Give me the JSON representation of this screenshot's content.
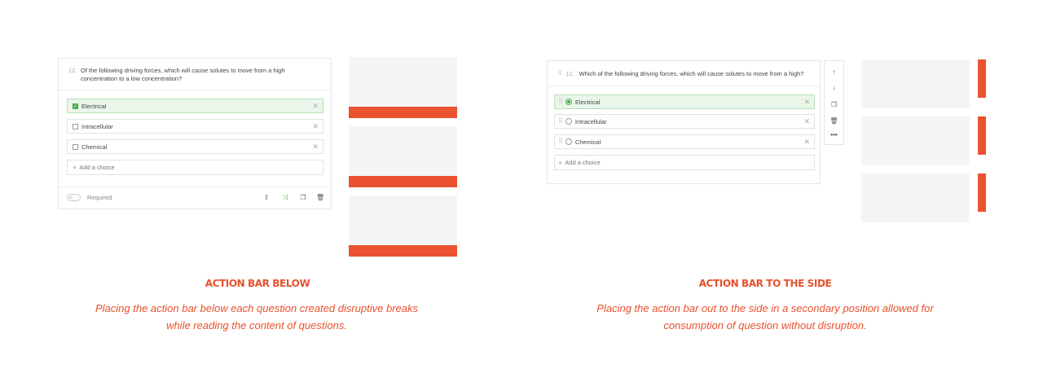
{
  "left": {
    "question": {
      "number": "12.",
      "text": "Of the following driving forces, which will cause solutes to move from a high concentration to a low concentration?"
    },
    "choices": [
      {
        "label": "Electrical",
        "selected": true
      },
      {
        "label": "Intracellular",
        "selected": false
      },
      {
        "label": "Chemical",
        "selected": false
      }
    ],
    "add_choice": "Add a choice",
    "required_label": "Required",
    "toolbar_icons": [
      "export-icon",
      "shuffle-icon",
      "duplicate-icon",
      "trash-icon"
    ],
    "caption_title": "ACTION BAR BELOW",
    "caption_text": "Placing the action bar below each question created disruptive breaks while reading the content of questions."
  },
  "right": {
    "question": {
      "number": "12.",
      "text": "Which of the following driving forces, which will cause solutes to move from a high?"
    },
    "choices": [
      {
        "label": "Electrical",
        "selected": true
      },
      {
        "label": "Intracellular",
        "selected": false
      },
      {
        "label": "Chemical",
        "selected": false
      }
    ],
    "add_choice": "Add a choice",
    "side_icons": [
      "arrow-up-icon",
      "arrow-down-icon",
      "duplicate-icon",
      "trash-icon",
      "more-icon"
    ],
    "caption_title": "ACTION BAR TO THE SIDE",
    "caption_text": "Placing the action bar out to the side in a secondary position allowed for consumption of question without disruption."
  },
  "colors": {
    "accent": "#ea5230",
    "selected_bg": "#eaf6ea",
    "check_green": "#4cae4c",
    "block_gray": "#f5f5f5"
  }
}
